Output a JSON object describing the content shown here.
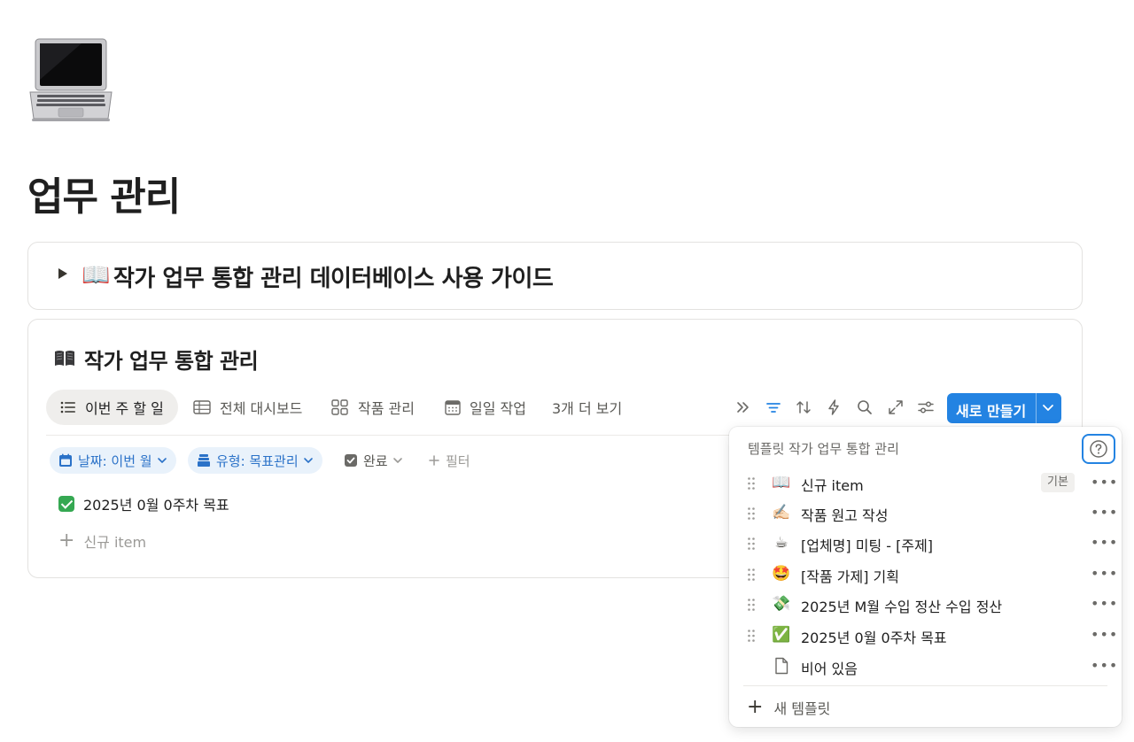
{
  "page": {
    "icon": "laptop-icon",
    "title": "업무 관리"
  },
  "guide_toggle": {
    "emoji": "📖",
    "title": "작가 업무 통합 관리 데이터베이스 사용 가이드"
  },
  "database": {
    "icon": "open-book-icon",
    "title": "작가 업무 통합 관리",
    "tabs": [
      {
        "label": "이번 주 할 일",
        "icon": "list-icon"
      },
      {
        "label": "전체 대시보드",
        "icon": "table-icon"
      },
      {
        "label": "작품 관리",
        "icon": "gallery-icon"
      },
      {
        "label": "일일 작업",
        "icon": "calendar-icon"
      },
      {
        "label": "3개 더 보기"
      }
    ],
    "toolbar_icons": [
      "double-chevron-icon",
      "filter-icon",
      "sort-icon",
      "automation-icon",
      "search-icon",
      "expand-icon",
      "settings-sliders-icon"
    ],
    "new_button": {
      "label": "새로 만들기"
    },
    "filters": [
      {
        "label": "날짜: 이번 월",
        "icon": "calendar-icon"
      },
      {
        "label": "유형: 목표관리",
        "icon": "stack-icon"
      },
      {
        "label": "완료",
        "icon": "checkbox-icon"
      },
      {
        "label": "필터"
      }
    ],
    "rows": [
      {
        "title": "2025년 0월 0주차 목표"
      }
    ],
    "new_row_label": "신규 item"
  },
  "template_popup": {
    "header": "템플릿 작가 업무 통합 관리",
    "templates": [
      {
        "emoji": "📖",
        "label": "신규 item",
        "badge": "기본"
      },
      {
        "emoji": "✍🏻",
        "label": "작품 원고 작성"
      },
      {
        "emoji": "☕",
        "label": "[업체명] 미팅 - [주제]"
      },
      {
        "emoji": "🤩",
        "label": "[작품 가제] 기획"
      },
      {
        "emoji": "💸",
        "label": "2025년 M월 수입 정산 수입 정산"
      },
      {
        "emoji": "✅",
        "label": "2025년 0월 0주차 목표"
      },
      {
        "emoji": "📄",
        "label": "비어 있음"
      }
    ],
    "more_label": "•••",
    "footer_label": "새 템플릿"
  },
  "colors": {
    "accent": "#2383e2",
    "chip_bg": "#e9f2fb",
    "chip_text": "#2b72c8",
    "done_green": "#35a852"
  }
}
